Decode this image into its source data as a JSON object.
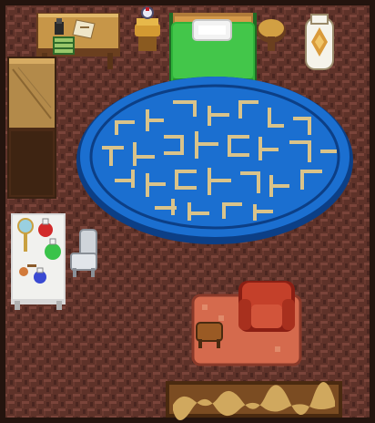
{
  "scene": {
    "type": "top-down pixel-art bedroom interior",
    "palette": {
      "wall_border": "#24140e",
      "floor_dark": "#5a2f28",
      "floor_light": "#7a443a",
      "rug_blue": "#1b6fd0",
      "rug_blue_dark": "#0c3f86",
      "rug_gold": "#d9c38a",
      "bed_green": "#2fb33a",
      "wood": "#b4893d",
      "wood_dark": "#6b3f1f",
      "armchair_red": "#c4402a",
      "lounge_rug": "#d56a4d",
      "bench_brown": "#7b4c22",
      "bench_tan": "#d0a85e",
      "vanity_white": "#f1f1ee",
      "vase_white": "#f5f3ea",
      "vase_orange": "#d99a3a"
    },
    "objects": [
      {
        "name": "desk-with-papers",
        "icon": "desk-icon",
        "interactable": true
      },
      {
        "name": "bookshelf-cabinet",
        "icon": "cabinet-icon",
        "interactable": true
      },
      {
        "name": "table-lamp",
        "icon": "lamp-icon",
        "interactable": true
      },
      {
        "name": "green-bed",
        "icon": "bed-icon",
        "interactable": true
      },
      {
        "name": "round-side-table",
        "icon": "table-icon",
        "interactable": true
      },
      {
        "name": "decorative-vase",
        "icon": "vase-icon",
        "interactable": true
      },
      {
        "name": "rune-rug",
        "icon": "rug-icon",
        "interactable": false
      },
      {
        "name": "vanity-with-potions",
        "icon": "potions-icon",
        "interactable": true
      },
      {
        "name": "white-chair",
        "icon": "chair-icon",
        "interactable": true
      },
      {
        "name": "red-armchair",
        "icon": "armchair-icon",
        "interactable": true
      },
      {
        "name": "small-stool",
        "icon": "stool-icon",
        "interactable": true
      },
      {
        "name": "entry-doormat",
        "icon": "doormat-icon",
        "interactable": true
      }
    ]
  }
}
